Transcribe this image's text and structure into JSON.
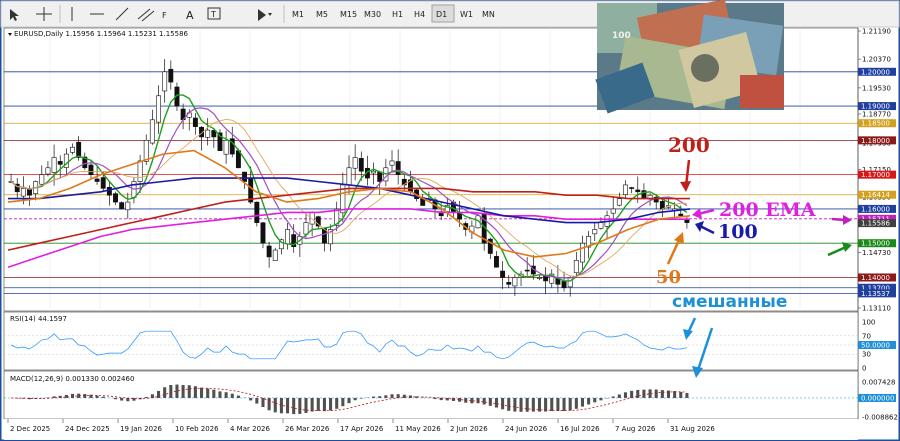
{
  "toolbar": {
    "timeframes": [
      "M1",
      "M5",
      "M15",
      "M30",
      "H1",
      "H4",
      "D1",
      "W1",
      "MN"
    ],
    "active_timeframe": "D1"
  },
  "chart_header": "EURUSD,Daily  1.15956 1.15964 1.15231 1.15586",
  "rsi_header": "RSI(14) 44.1597",
  "macd_header": "MACD(12,26,9) 0.001330 0.002460",
  "annotations": {
    "label_200": "200",
    "label_200ema": "200 EMA",
    "label_100": "100",
    "label_50": "50",
    "label_mixed": "смешанные"
  },
  "colors": {
    "ma200": "#c0201a",
    "ema200": "#e020e0",
    "ma100": "#1a1aa8",
    "ma50": "#e07818",
    "mixed": "#1e90d8",
    "green_arrow": "#1a8a1a"
  },
  "chart_data": {
    "type": "candlestick",
    "symbol": "EURUSD",
    "timeframe": "Daily",
    "ohlc_last": {
      "open": 1.15956,
      "high": 1.15964,
      "low": 1.15231,
      "close": 1.15586
    },
    "ylim": [
      1.1311,
      1.2119
    ],
    "price_ticks": [
      "1.21190",
      "1.20370",
      "1.19530",
      "1.18770",
      "1.17930",
      "1.17150",
      "1.16350",
      "1.15550",
      "1.14730",
      "1.13950",
      "1.13110"
    ],
    "level_labels": [
      {
        "price": 1.2,
        "text": "1.20000",
        "color": "#2040a0"
      },
      {
        "price": 1.19,
        "text": "1.19000",
        "color": "#2040a0"
      },
      {
        "price": 1.185,
        "text": "1.18500",
        "color": "#d4a020"
      },
      {
        "price": 1.18,
        "text": "1.18000",
        "color": "#8b1a1a"
      },
      {
        "price": 1.17,
        "text": "1.17000",
        "color": "#d81818"
      },
      {
        "price": 1.16414,
        "text": "1.16414",
        "color": "#d4a020"
      },
      {
        "price": 1.16,
        "text": "1.16000",
        "color": "#2040a0"
      },
      {
        "price": 1.15711,
        "text": "1.15711",
        "color": "#c020c0"
      },
      {
        "price": 1.15586,
        "text": "1.15586",
        "color": "#404040"
      },
      {
        "price": 1.15,
        "text": "1.15000",
        "color": "#1a8a1a"
      },
      {
        "price": 1.14,
        "text": "1.14000",
        "color": "#8b1a1a"
      },
      {
        "price": 1.137,
        "text": "1.13700",
        "color": "#2040a0"
      },
      {
        "price": 1.13537,
        "text": "1.13537",
        "color": "#2040a0"
      }
    ],
    "date_labels": [
      "2 Dec 2025",
      "24 Dec 2025",
      "19 Jan 2026",
      "10 Feb 2026",
      "4 Mar 2026",
      "26 Mar 2026",
      "17 Apr 2026",
      "11 May 2026",
      "2 Jun 2026",
      "24 Jun 2026",
      "16 Jul 2026",
      "7 Aug 2026",
      "31 Aug 2026"
    ],
    "close_path": [
      1.168,
      1.165,
      1.166,
      1.164,
      1.168,
      1.17,
      1.172,
      1.175,
      1.173,
      1.176,
      1.178,
      1.175,
      1.172,
      1.17,
      1.168,
      1.166,
      1.164,
      1.162,
      1.16,
      1.162,
      1.168,
      1.174,
      1.18,
      1.186,
      1.193,
      1.2,
      1.197,
      1.19,
      1.186,
      1.188,
      1.184,
      1.181,
      1.183,
      1.181,
      1.177,
      1.18,
      1.176,
      1.172,
      1.168,
      1.162,
      1.156,
      1.15,
      1.146,
      1.148,
      1.151,
      1.154,
      1.149,
      1.152,
      1.156,
      1.159,
      1.155,
      1.15,
      1.154,
      1.16,
      1.167,
      1.172,
      1.175,
      1.171,
      1.169,
      1.171,
      1.168,
      1.172,
      1.174,
      1.17,
      1.167,
      1.165,
      1.163,
      1.161,
      1.163,
      1.16,
      1.158,
      1.161,
      1.159,
      1.157,
      1.154,
      1.155,
      1.158,
      1.15,
      1.147,
      1.143,
      1.14,
      1.138,
      1.14,
      1.141,
      1.142,
      1.141,
      1.14,
      1.139,
      1.141,
      1.138,
      1.137,
      1.14,
      1.145,
      1.15,
      1.152,
      1.154,
      1.156,
      1.158,
      1.16,
      1.163,
      1.167,
      1.166,
      1.165,
      1.163,
      1.164,
      1.162,
      1.16,
      1.161,
      1.16,
      1.158,
      1.156
    ],
    "ma_series": [
      {
        "name": "200",
        "color": "#c0201a",
        "values": [
          1.148,
          1.15,
          1.152,
          1.154,
          1.156,
          1.158,
          1.16,
          1.162,
          1.163,
          1.164,
          1.165,
          1.166,
          1.166,
          1.166,
          1.166,
          1.165,
          1.165,
          1.165,
          1.164,
          1.164,
          1.163,
          1.163,
          1.163
        ]
      },
      {
        "name": "200 EMA",
        "color": "#e020e0",
        "values": [
          1.143,
          1.146,
          1.149,
          1.152,
          1.154,
          1.155,
          1.156,
          1.157,
          1.158,
          1.159,
          1.159,
          1.16,
          1.16,
          1.16,
          1.159,
          1.159,
          1.158,
          1.158,
          1.157,
          1.157,
          1.157,
          1.157,
          1.157
        ]
      },
      {
        "name": "100",
        "color": "#1a1aa8",
        "values": [
          1.163,
          1.163,
          1.164,
          1.165,
          1.167,
          1.168,
          1.169,
          1.169,
          1.169,
          1.169,
          1.168,
          1.167,
          1.166,
          1.164,
          1.162,
          1.16,
          1.158,
          1.157,
          1.156,
          1.156,
          1.157,
          1.159,
          1.16
        ]
      },
      {
        "name": "50",
        "color": "#e07818",
        "values": [
          1.162,
          1.163,
          1.166,
          1.17,
          1.173,
          1.176,
          1.177,
          1.172,
          1.165,
          1.162,
          1.163,
          1.165,
          1.166,
          1.165,
          1.16,
          1.153,
          1.148,
          1.146,
          1.147,
          1.15,
          1.154,
          1.157,
          1.158
        ]
      }
    ],
    "rsi": {
      "label": "RSI(14) 44.1597",
      "ticks": [
        "100",
        "70",
        "50.0000",
        "30",
        "0"
      ],
      "value": 44.1597
    },
    "macd": {
      "label": "MACD(12,26,9) 0.001330 0.002460",
      "ticks": [
        "0.007428",
        "0.000000",
        "-0.008862"
      ],
      "main": 0.00133,
      "signal": 0.00246
    }
  }
}
